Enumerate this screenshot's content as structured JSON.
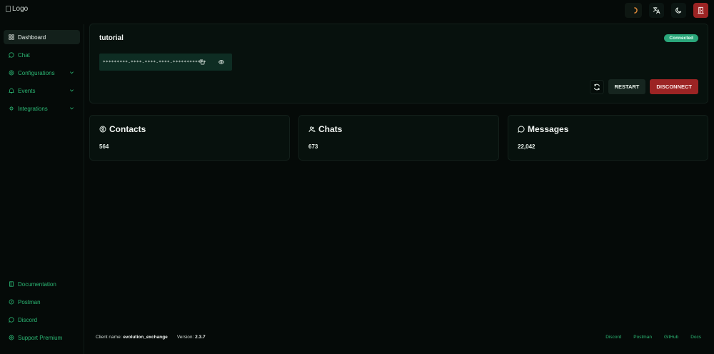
{
  "header": {
    "logo_alt": "Logo",
    "buttons": [
      {
        "name": "avatar-button",
        "icon": "avatar-icon"
      },
      {
        "name": "language-button",
        "icon": "translate-icon"
      },
      {
        "name": "theme-toggle-button",
        "icon": "moon-icon"
      },
      {
        "name": "logout-button",
        "icon": "logout-icon"
      }
    ]
  },
  "sidebar": {
    "items": [
      {
        "label": "Dashboard",
        "icon": "dashboard-icon",
        "active": true
      },
      {
        "label": "Chat",
        "icon": "chat-icon"
      },
      {
        "label": "Configurations",
        "icon": "gear-icon",
        "expandable": true
      },
      {
        "label": "Events",
        "icon": "bell-icon",
        "expandable": true
      },
      {
        "label": "Integrations",
        "icon": "puzzle-icon",
        "expandable": true
      }
    ],
    "bottom_items": [
      {
        "label": "Documentation",
        "icon": "book-icon"
      },
      {
        "label": "Postman",
        "icon": "postman-icon"
      },
      {
        "label": "Discord",
        "icon": "discord-icon"
      },
      {
        "label": "Support Premium",
        "icon": "support-icon"
      }
    ]
  },
  "instance": {
    "name": "tutorial",
    "status": "Connected",
    "token_masked": "*********-****-****-****-************",
    "restart_label": "RESTART",
    "disconnect_label": "DISCONNECT"
  },
  "stats": [
    {
      "title": "Contacts",
      "value": "564",
      "icon": "contacts-icon"
    },
    {
      "title": "Chats",
      "value": "673",
      "icon": "users-icon"
    },
    {
      "title": "Messages",
      "value": "22,042",
      "icon": "message-icon"
    }
  ],
  "footer": {
    "client_label": "Client name:",
    "client_name": "evolution_exchange",
    "version_label": "Version:",
    "version": "2.3.7",
    "links": [
      "Discord",
      "Postman",
      "GitHub",
      "Docs"
    ]
  },
  "colors": {
    "background": "#050a08",
    "accent": "#2bb673",
    "danger": "#9c2424",
    "success_badge": "#2aa67a"
  }
}
